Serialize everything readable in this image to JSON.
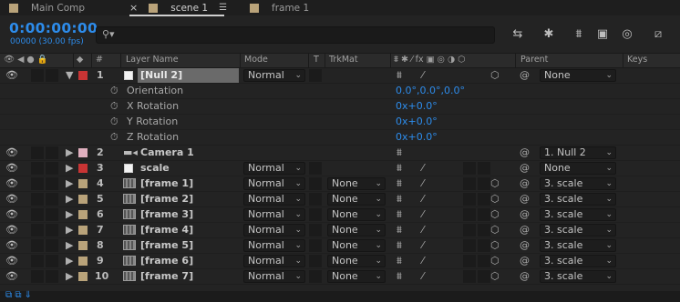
{
  "tabs": [
    {
      "label": "Main Comp",
      "active": false
    },
    {
      "label": "scene 1",
      "active": true
    },
    {
      "label": "frame 1",
      "active": false
    }
  ],
  "timecode": "0:00:00:00",
  "fps_text": "00000 (30.00 fps)",
  "search": {
    "placeholder": "",
    "icon": "search-icon"
  },
  "toolbar_icons": [
    "comp-flowchart-icon",
    "draft-3d-icon",
    "shy-icon",
    "frame-blending-icon",
    "motion-blur-icon",
    "graph-editor-icon"
  ],
  "columns": {
    "num": "#",
    "layer_name": "Layer Name",
    "mode": "Mode",
    "t": "T",
    "trkmat": "TrkMat",
    "parent": "Parent",
    "keys": "Keys"
  },
  "colors": {
    "accent": "#2d8ceb",
    "label_tan": "#b9a37a",
    "label_red": "#c83434",
    "label_pink": "#e0b0bf"
  },
  "null_layer": {
    "num": "1",
    "name": "[Null 2]",
    "mode": "Normal",
    "parent": "None"
  },
  "properties": [
    {
      "name": "Orientation",
      "value": "0.0°,0.0°,0.0°"
    },
    {
      "name": "X Rotation",
      "value": "0x+0.0°"
    },
    {
      "name": "Y Rotation",
      "value": "0x+0.0°"
    },
    {
      "name": "Z Rotation",
      "value": "0x+0.0°"
    }
  ],
  "camera_layer": {
    "num": "2",
    "name": "Camera 1",
    "parent": "1. Null 2"
  },
  "scale_layer": {
    "num": "3",
    "name": "scale",
    "mode": "Normal",
    "parent": "None"
  },
  "frame_layers": [
    {
      "num": "4",
      "name": "[frame 1]",
      "mode": "Normal",
      "trkmat": "None",
      "parent": "3. scale"
    },
    {
      "num": "5",
      "name": "[frame 2]",
      "mode": "Normal",
      "trkmat": "None",
      "parent": "3. scale"
    },
    {
      "num": "6",
      "name": "[frame 3]",
      "mode": "Normal",
      "trkmat": "None",
      "parent": "3. scale"
    },
    {
      "num": "7",
      "name": "[frame 4]",
      "mode": "Normal",
      "trkmat": "None",
      "parent": "3. scale"
    },
    {
      "num": "8",
      "name": "[frame 5]",
      "mode": "Normal",
      "trkmat": "None",
      "parent": "3. scale"
    },
    {
      "num": "9",
      "name": "[frame 6]",
      "mode": "Normal",
      "trkmat": "None",
      "parent": "3. scale"
    },
    {
      "num": "10",
      "name": "[frame 7]",
      "mode": "Normal",
      "trkmat": "None",
      "parent": "3. scale"
    }
  ]
}
